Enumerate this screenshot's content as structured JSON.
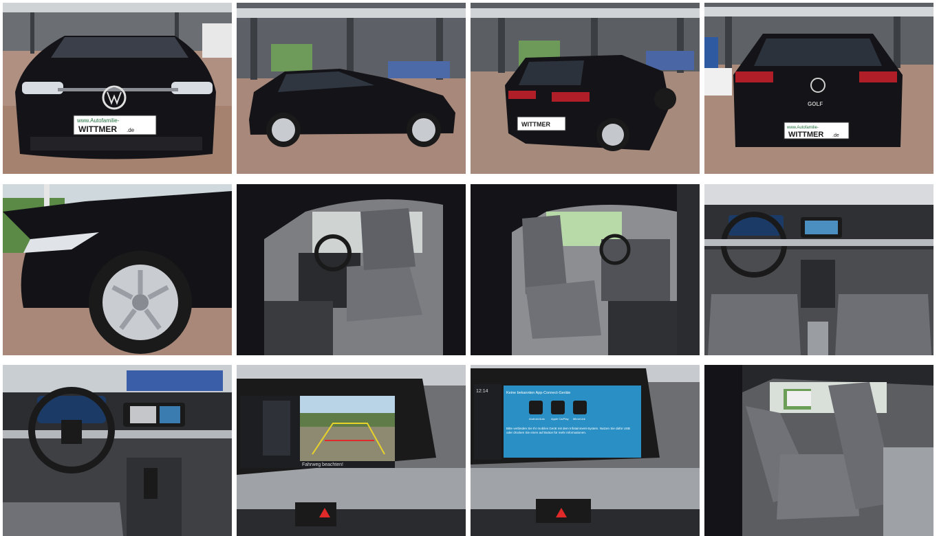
{
  "gallery": {
    "photos": [
      {
        "subject": "front exterior",
        "plate_line1": "www.Autofamilie-",
        "plate_line2": "WITTMER",
        "plate_suffix": ".de"
      },
      {
        "subject": "side profile exterior"
      },
      {
        "subject": "rear three-quarter exterior",
        "plate_text": "WITTMER"
      },
      {
        "subject": "rear exterior",
        "plate_line1": "www.Autofamilie-",
        "plate_line2": "WITTMER",
        "plate_suffix": ".de",
        "badge": "GOLF"
      },
      {
        "subject": "front wheel close-up"
      },
      {
        "subject": "driver door open interior"
      },
      {
        "subject": "passenger door open interior"
      },
      {
        "subject": "dashboard and front seats"
      },
      {
        "subject": "cockpit and steering wheel"
      },
      {
        "subject": "rear view camera screen",
        "screen_caption": "Fahrweg beachten!"
      },
      {
        "subject": "infotainment App-Connect screen",
        "screen_time": "12:14",
        "screen_title": "Keine bekannten App-Connect-Geräte",
        "screen_app1": "Android Auto",
        "screen_app2": "Apple CarPlay",
        "screen_app3": "MirrorLink",
        "screen_msg": "Bitte verbinden Sie Ihr mobiles Gerät mit dem Infotainment-System. Nutzen Sie dafür USB oder drücken Sie einen auf Button für mehr Informationen."
      },
      {
        "subject": "rear seats interior"
      }
    ]
  },
  "colors": {
    "car_body": "#141418",
    "pavement": "#a88a78",
    "roof": "#5a5d62",
    "interior_seat": "#6f7176",
    "screen_blue": "#2a8fc4"
  }
}
